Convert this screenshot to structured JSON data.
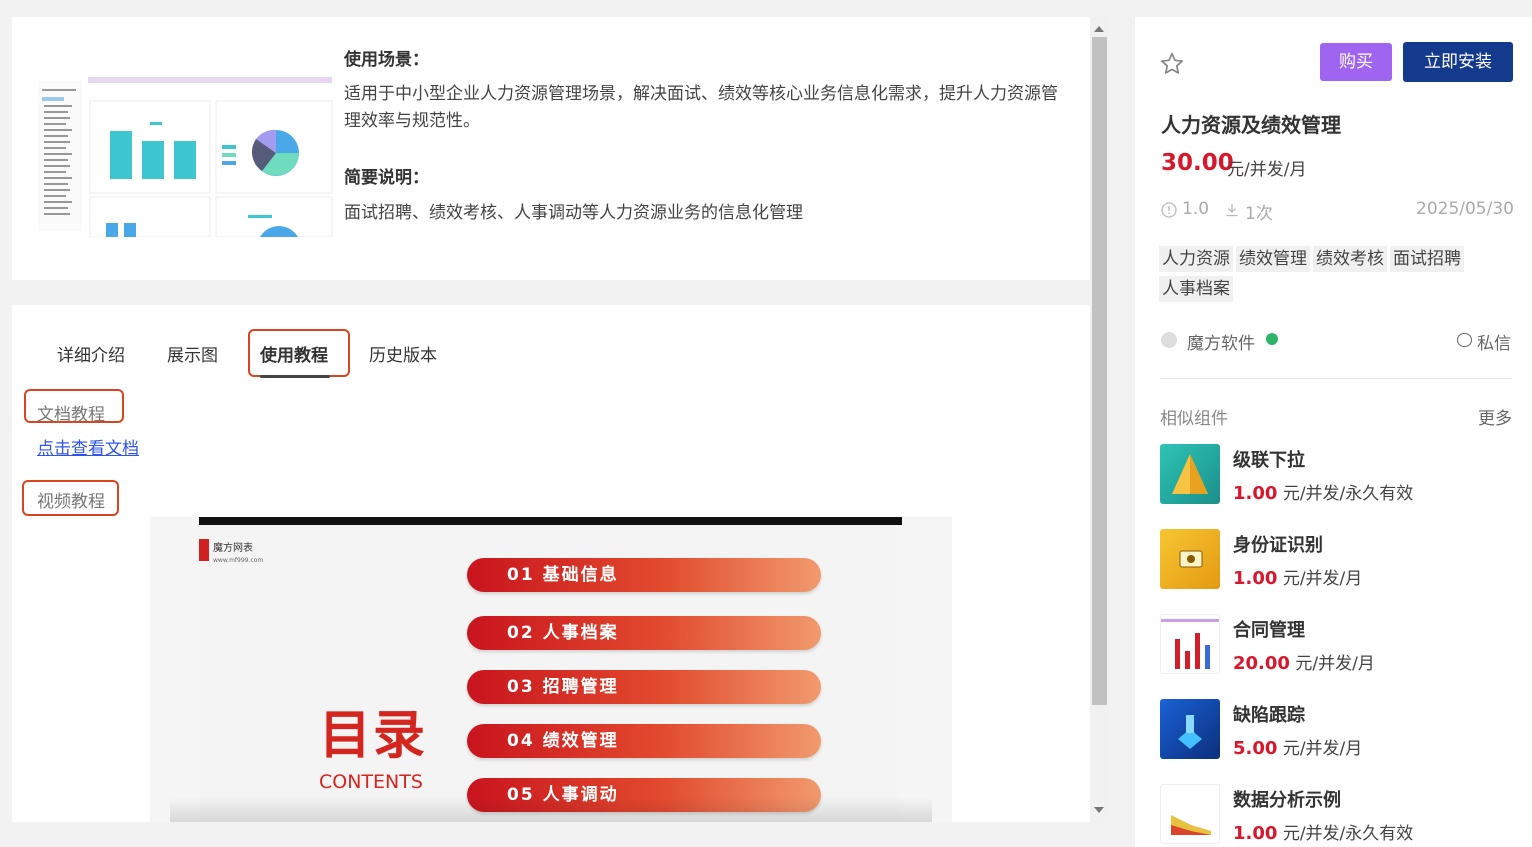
{
  "overview": {
    "scene_title": "使用场景：",
    "scene_text": "适用于中小型企业人力资源管理场景，解决面试、绩效等核心业务信息化需求，提升人力资源管理效率与规范性。",
    "brief_title": "简要说明：",
    "brief_text": "面试招聘、绩效考核、人事调动等人力资源业务的信息化管理"
  },
  "tabs": [
    {
      "label": "详细介绍",
      "active": false
    },
    {
      "label": "展示图",
      "active": false
    },
    {
      "label": "使用教程",
      "active": true
    },
    {
      "label": "历史版本",
      "active": false
    }
  ],
  "tutorial": {
    "doc_label": "文档教程",
    "doc_link": "点击查看文档",
    "video_label": "视频教程"
  },
  "video": {
    "brand": "魔方网表",
    "brand_sub": "www.mf999.com",
    "title": "目录",
    "subtitle": "CONTENTS",
    "items": [
      "01  基础信息",
      "02  人事档案",
      "03  招聘管理",
      "04  绩效管理",
      "05  人事调动"
    ]
  },
  "product": {
    "buy_label": "购买",
    "install_label": "立即安装",
    "title": "人力资源及绩效管理",
    "price": "30.00",
    "price_unit": "元/并发/月",
    "version": "1.0",
    "downloads": "1次",
    "date": "2025/05/30",
    "tags": [
      "人力资源",
      "绩效管理",
      "绩效考核",
      "面试招聘",
      "人事档案"
    ],
    "vendor": "魔方软件",
    "message_label": "私信"
  },
  "similar": {
    "title": "相似组件",
    "more_label": "更多",
    "items": [
      {
        "name": "级联下拉",
        "price": "1.00",
        "unit": " 元/并发/永久有效"
      },
      {
        "name": "身份证识别",
        "price": "1.00",
        "unit": " 元/并发/月"
      },
      {
        "name": "合同管理",
        "price": "20.00",
        "unit": " 元/并发/月"
      },
      {
        "name": "缺陷跟踪",
        "price": "5.00",
        "unit": " 元/并发/月"
      },
      {
        "name": "数据分析示例",
        "price": "1.00",
        "unit": " 元/并发/永久有效"
      }
    ]
  },
  "colors": {
    "accent_red": "#d7172c",
    "buy_purple": "#a065f0",
    "install_navy": "#133a8c",
    "highlight": "#d9451f",
    "link_blue": "#2f54eb"
  }
}
